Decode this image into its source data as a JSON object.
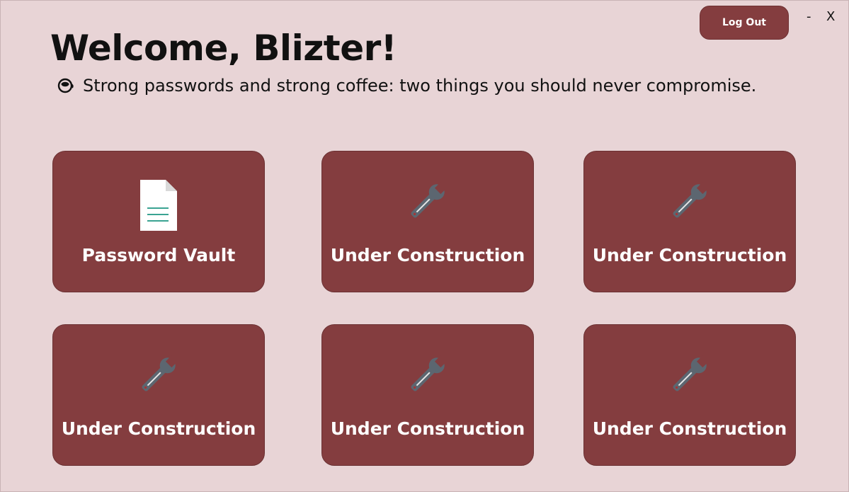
{
  "header": {
    "logout_label": "Log Out",
    "minimize_label": "-",
    "close_label": "X",
    "welcome": "Welcome, Blizter!",
    "tagline": "Strong passwords and strong coffee: two things you should never compromise.",
    "tagline_icon": "coffee-cup-icon"
  },
  "tiles": [
    {
      "label": "Password Vault",
      "icon": "document-icon"
    },
    {
      "label": "Under Construction",
      "icon": "wrench-icon"
    },
    {
      "label": "Under Construction",
      "icon": "wrench-icon"
    },
    {
      "label": "Under Construction",
      "icon": "wrench-icon"
    },
    {
      "label": "Under Construction",
      "icon": "wrench-icon"
    },
    {
      "label": "Under Construction",
      "icon": "wrench-icon"
    }
  ],
  "colors": {
    "background": "#e8d4d6",
    "tile": "#843d3f",
    "tile_text": "#ffffff",
    "document_lines": "#3aa392",
    "wrench": "#5c6670"
  }
}
